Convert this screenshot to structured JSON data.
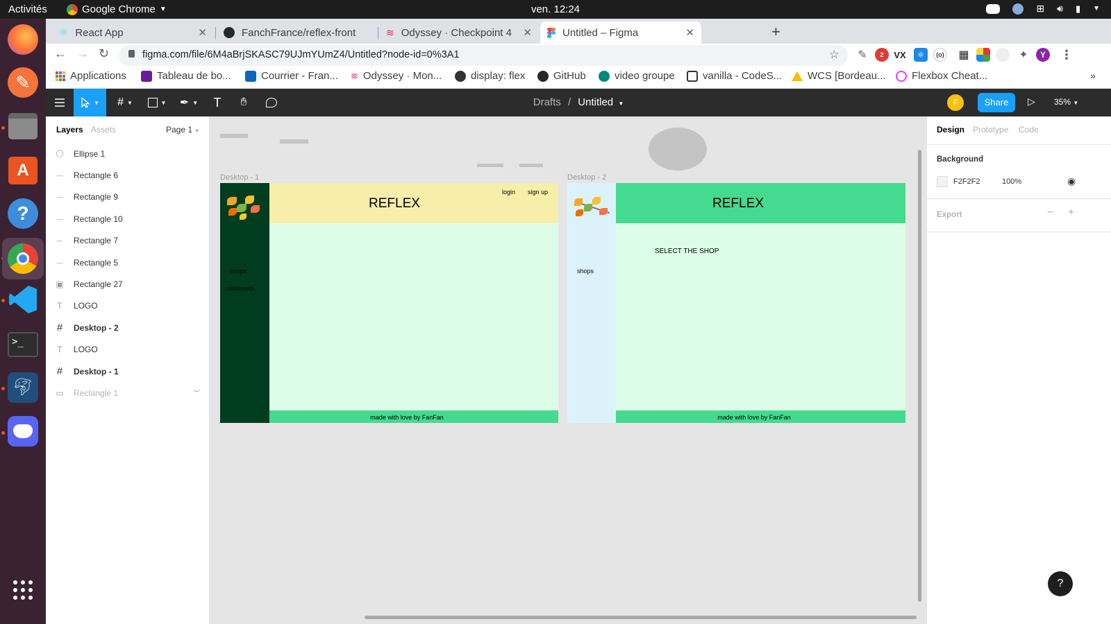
{
  "os": {
    "activities": "Activités",
    "app_name": "Google Chrome",
    "clock": "ven. 12:24",
    "discord_badge": "2"
  },
  "browser": {
    "tabs": [
      {
        "label": "React App",
        "favicon": "react-icon"
      },
      {
        "label": "FanchFrance/reflex-front",
        "favicon": "github-icon"
      },
      {
        "label": "Odyssey · Checkpoint 4",
        "favicon": "odyssey-icon"
      },
      {
        "label": "Untitled – Figma",
        "favicon": "figma-icon",
        "active": true
      }
    ],
    "url": "figma.com/file/6M4aBrjSKASC79UJmYUmZ4/Untitled?node-id=0%3A1",
    "profile_initial": "Y",
    "bookmarks": [
      {
        "label": "Applications",
        "icon": "apps-grid-icon",
        "color": "#4285f4"
      },
      {
        "label": "Tableau de bo...",
        "icon": "tableau-icon",
        "color": "#6a1b9a"
      },
      {
        "label": "Courrier - Fran...",
        "icon": "outlook-icon",
        "color": "#0a66c2"
      },
      {
        "label": "Odyssey · Mon...",
        "icon": "odyssey-icon",
        "color": "#e91e63"
      },
      {
        "label": "display: flex",
        "icon": "globe-icon",
        "color": "#333333"
      },
      {
        "label": "GitHub",
        "icon": "github-icon",
        "color": "#24292e"
      },
      {
        "label": "video groupe",
        "icon": "meet-icon",
        "color": "#00897b"
      },
      {
        "label": "vanilla - CodeS...",
        "icon": "codesandbox-icon",
        "color": "#333333"
      },
      {
        "label": "WCS [Bordeau...",
        "icon": "drive-icon",
        "color": "#fbbc04"
      },
      {
        "label": "Flexbox Cheat...",
        "icon": "flexbox-icon",
        "color": "#e040fb"
      }
    ]
  },
  "figma": {
    "breadcrumb_parent": "Drafts",
    "breadcrumb_separator": "/",
    "file_name": "Untitled",
    "user_initial": "F",
    "share_label": "Share",
    "zoom": "35%",
    "left_tabs": {
      "layers": "Layers",
      "assets": "Assets",
      "page": "Page 1"
    },
    "layers": [
      {
        "name": "Ellipse 1",
        "icon": "ellipse-icon",
        "kind": "shape"
      },
      {
        "name": "Rectangle 6",
        "icon": "line-icon",
        "kind": "shape"
      },
      {
        "name": "Rectangle 9",
        "icon": "line-icon",
        "kind": "shape"
      },
      {
        "name": "Rectangle 10",
        "icon": "line-icon",
        "kind": "shape"
      },
      {
        "name": "Rectangle 7",
        "icon": "line-icon",
        "kind": "shape"
      },
      {
        "name": "Rectangle 5",
        "icon": "line-icon",
        "kind": "shape"
      },
      {
        "name": "Rectangle 27",
        "icon": "image-icon",
        "kind": "shape"
      },
      {
        "name": "LOGO",
        "icon": "text-icon",
        "kind": "shape"
      },
      {
        "name": "Desktop - 2",
        "icon": "frame-icon",
        "kind": "frame"
      },
      {
        "name": "LOGO",
        "icon": "text-icon",
        "kind": "shape"
      },
      {
        "name": "Desktop - 1",
        "icon": "frame-icon",
        "kind": "frame"
      },
      {
        "name": "Rectangle 1",
        "icon": "rectangle-icon",
        "kind": "hidden"
      }
    ],
    "right_tabs": {
      "design": "Design",
      "prototype": "Prototype",
      "code": "Code"
    },
    "background": {
      "label": "Background",
      "hex": "F2F2F2",
      "opacity": "100%"
    },
    "export": {
      "label": "Export"
    },
    "help": "?",
    "frames": {
      "desktop1": {
        "label": "Desktop - 1",
        "brand": "REFLEX",
        "login": "login",
        "signup": "sign up",
        "nav": [
          "shops",
          "customers"
        ],
        "footer": "made with love by FanFan",
        "colors": {
          "sidebar": "#003d1f",
          "header": "#f7eeaa",
          "body": "#ddfde9",
          "footer": "#44da8f"
        }
      },
      "desktop2": {
        "label": "Desktop - 2",
        "brand": "REFLEX",
        "heading": "SELECT THE SHOP",
        "nav": [
          "shops"
        ],
        "footer": "made with love by FanFan",
        "colors": {
          "sidebar": "#dcf2fa",
          "header": "#44da8f",
          "body": "#ddfde9",
          "footer": "#44da8f"
        }
      }
    }
  }
}
